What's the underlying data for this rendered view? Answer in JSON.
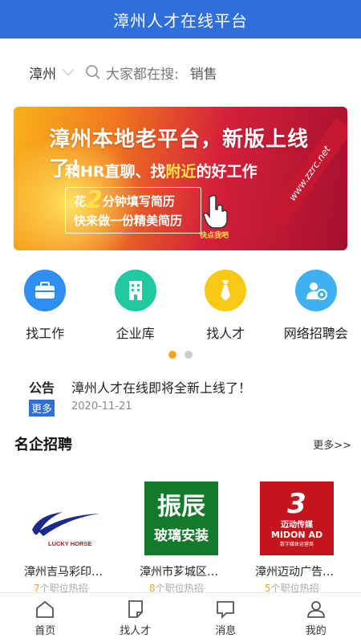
{
  "header": {
    "title": "漳州人才在线平台"
  },
  "search": {
    "city": "漳州",
    "prefix": "大家都在搜:",
    "keyword": "销售"
  },
  "banner": {
    "line1": "漳州本地老平台，新版上线了！",
    "line2_a": "和HR直聊、找",
    "line2_b": "附近",
    "line2_c": "的好工作",
    "box_a": "花",
    "box_num": "2",
    "box_b": "分钟填写简历",
    "box_line2": "快来做一份精美简历",
    "tap": "快点我吧",
    "site": "www.zzrc.net"
  },
  "quick_links": [
    {
      "label": "找工作",
      "icon": "briefcase-icon",
      "color": "#2f8ff0"
    },
    {
      "label": "企业库",
      "icon": "building-icon",
      "color": "#22c9a0"
    },
    {
      "label": "找人才",
      "icon": "tie-icon",
      "color": "#f7c915"
    },
    {
      "label": "网络招聘会",
      "icon": "video-recruit-icon",
      "color": "#3fb1f2"
    }
  ],
  "notice": {
    "tag": "公告",
    "text": "漳州人才在线即将全新上线了！",
    "more": "更多",
    "date": "2020-11-21"
  },
  "section": {
    "title": "名企招聘",
    "more": "更多>>"
  },
  "companies": [
    {
      "name": "漳州吉马彩印…",
      "count": "7",
      "suffix": "个职位热招",
      "logo_text": "LUCKY HORSE"
    },
    {
      "name": "漳州市芗城区…",
      "count": "8",
      "suffix": "个职位热招",
      "logo_text_1": "振辰",
      "logo_text_2": "玻璃安装"
    },
    {
      "name": "漳州迈动广告…",
      "count": "5",
      "suffix": "个职位热招",
      "logo_text_1": "迈动传媒",
      "logo_text_2": "MIDON AD",
      "logo_text_3": "数字媒体运营商"
    }
  ],
  "tabs": [
    {
      "label": "首页",
      "icon": "home-icon"
    },
    {
      "label": "找人才",
      "icon": "document-icon"
    },
    {
      "label": "消息",
      "icon": "message-icon"
    },
    {
      "label": "我的",
      "icon": "user-icon"
    }
  ]
}
